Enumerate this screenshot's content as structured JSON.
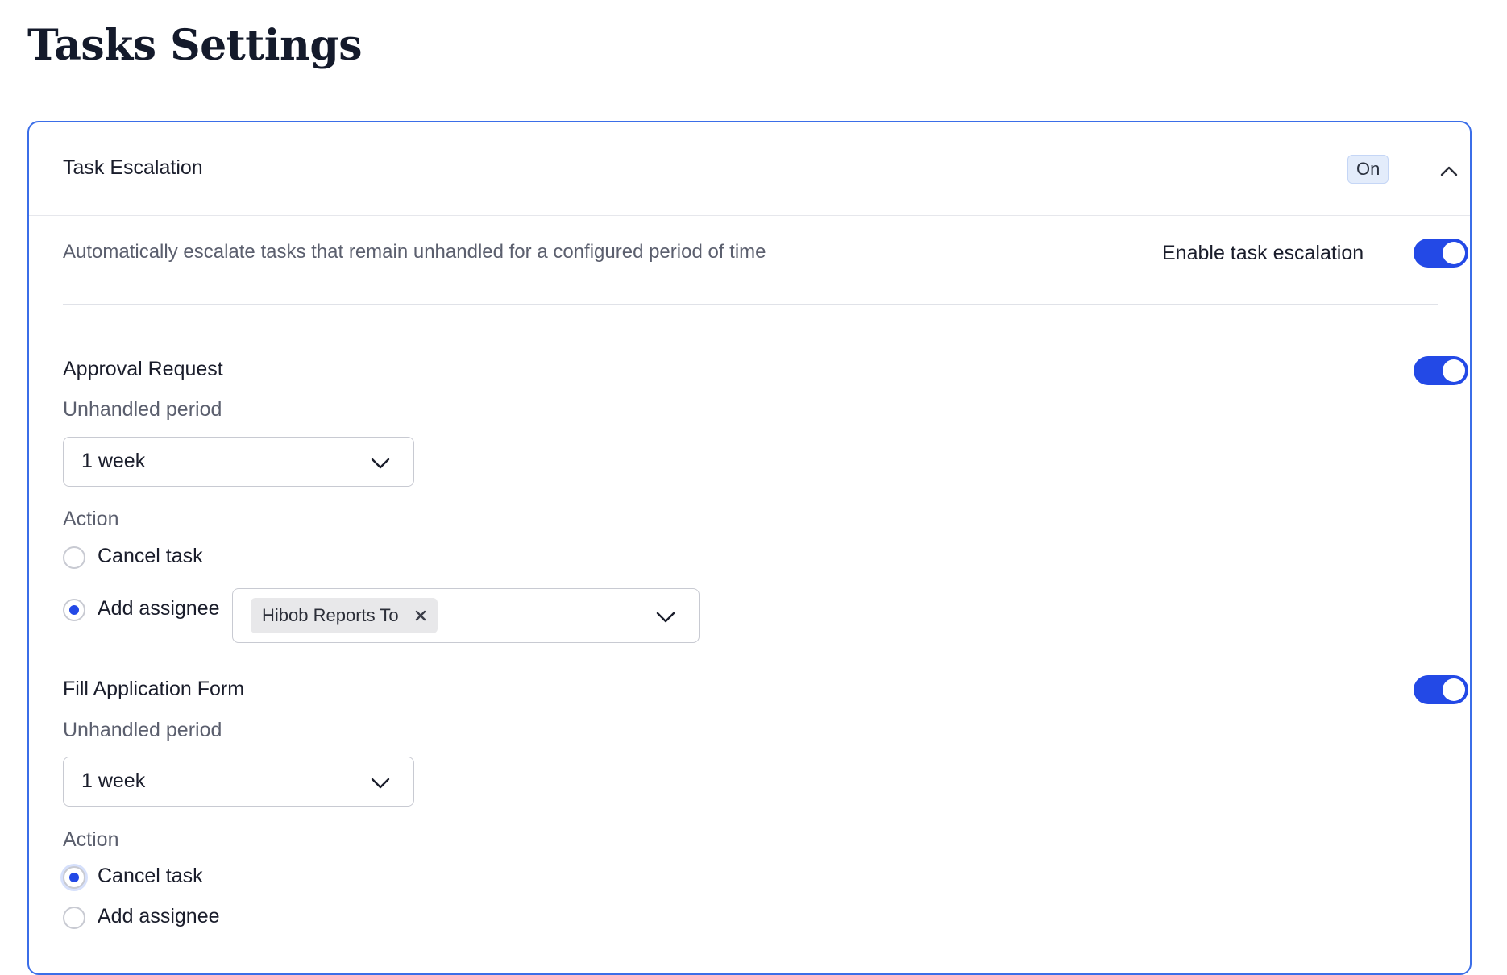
{
  "page": {
    "title": "Tasks Settings"
  },
  "escalation": {
    "title": "Task Escalation",
    "status": "On",
    "description": "Automatically escalate tasks that remain unhandled for a configured period of time",
    "enable_label": "Enable task escalation",
    "enabled": true
  },
  "sections": [
    {
      "title": "Approval Request",
      "enabled": true,
      "period_label": "Unhandled period",
      "period_value": "1 week",
      "action_label": "Action",
      "options": [
        "Cancel task",
        "Add assignee"
      ],
      "selected": "Add assignee",
      "assignee_chip": "Hibob Reports To"
    },
    {
      "title": "Fill Application Form",
      "enabled": true,
      "period_label": "Unhandled period",
      "period_value": "1 week",
      "action_label": "Action",
      "options": [
        "Cancel task",
        "Add assignee"
      ],
      "selected": "Cancel task"
    }
  ],
  "colors": {
    "accent": "#2349e6",
    "card_border": "#3b6ee8",
    "badge_bg": "#e3ecfb"
  },
  "icons": {
    "collapse": "chevron-up-icon",
    "dropdown": "chevron-down-icon",
    "remove": "close-icon"
  }
}
